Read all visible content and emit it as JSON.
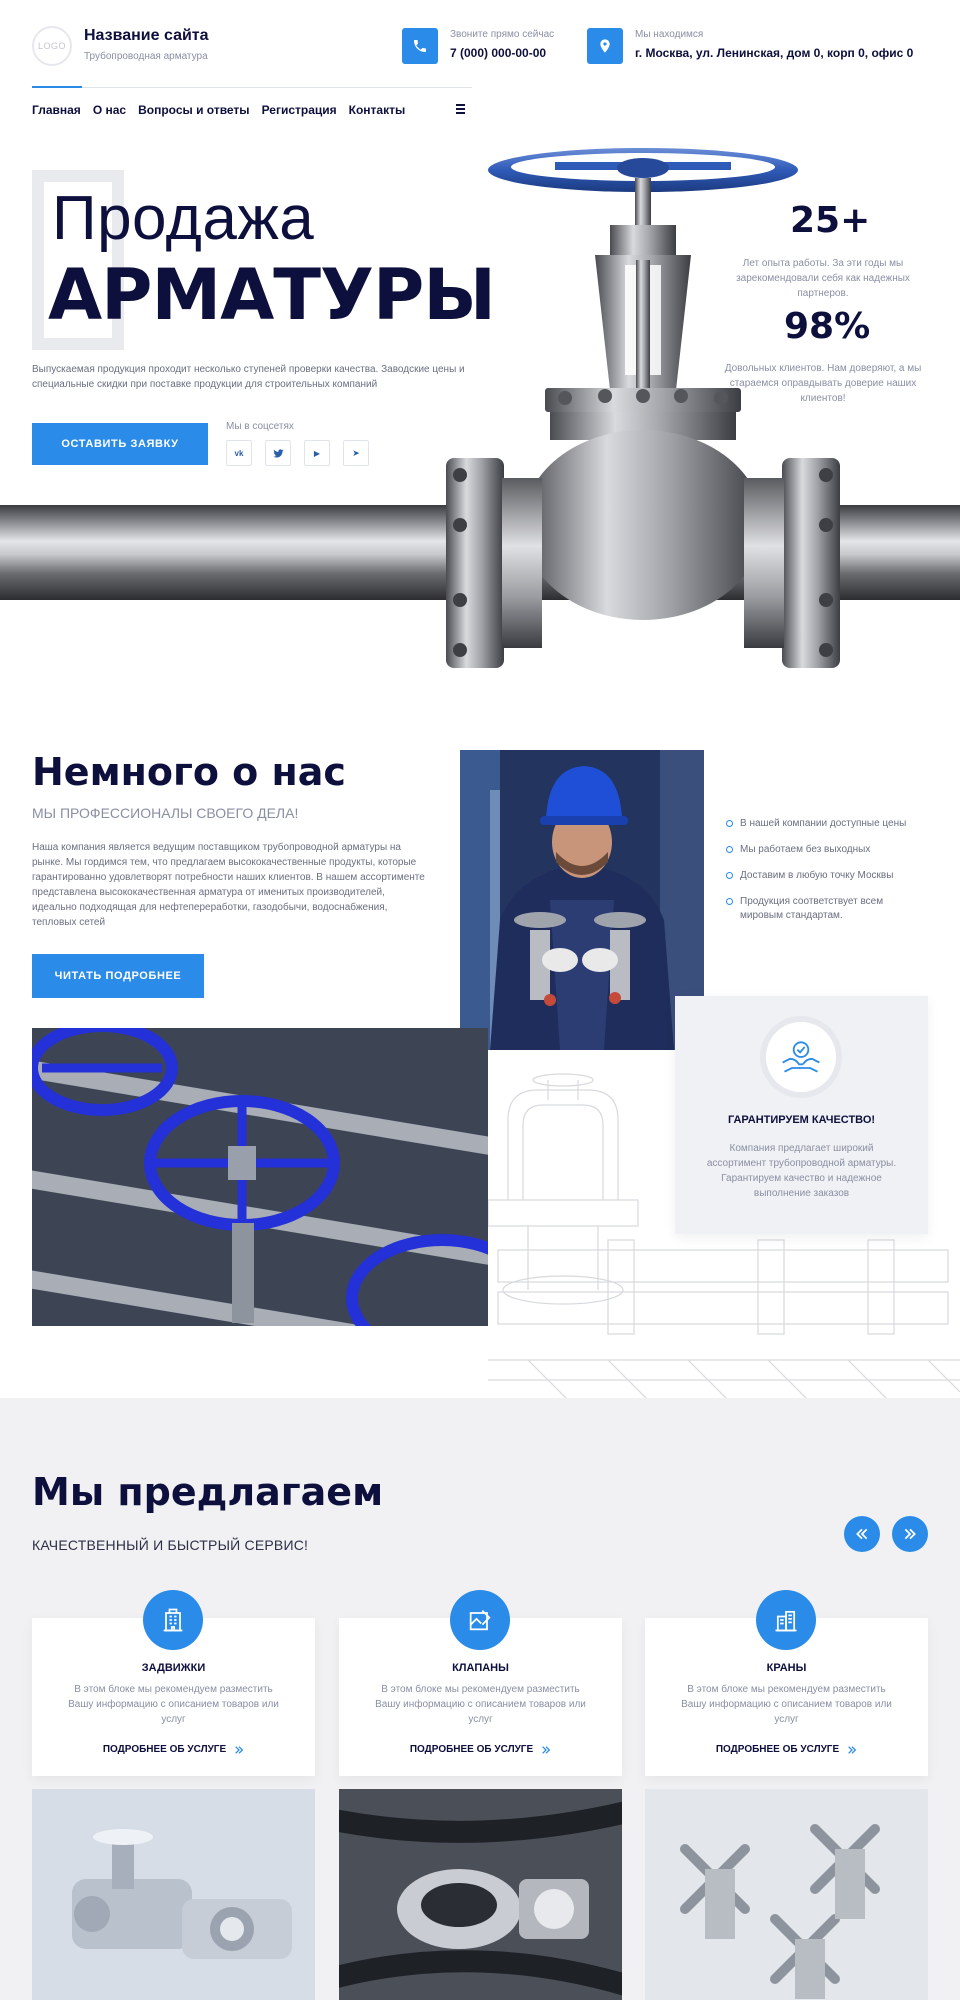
{
  "header": {
    "logo_text": "LOGO",
    "site_name": "Название сайта",
    "site_subtitle": "Трубопроводная арматура",
    "phone_label": "Звоните прямо сейчас",
    "phone_value": "7 (000) 000-00-00",
    "address_label": "Мы находимся",
    "address_value": "г. Москва, ул. Ленинская, дом 0, корп 0, офис 0"
  },
  "nav": {
    "items": [
      "Главная",
      "О нас",
      "Вопросы и ответы",
      "Регистрация",
      "Контакты"
    ],
    "active_index": 0
  },
  "hero": {
    "title_line1": "Продажа",
    "title_line2": "АРМАТУРЫ",
    "description": "Выпускаемая продукция проходит несколько ступеней проверки качества. Заводские цены и специальные скидки при поставке продукции для строительных компаний",
    "cta_label": "ОСТАВИТЬ ЗАЯВКУ",
    "socials_label": "Мы в соцсетях",
    "socials": [
      {
        "icon": "vk-icon",
        "glyph": "vk"
      },
      {
        "icon": "twitter-icon",
        "glyph": "t"
      },
      {
        "icon": "youtube-icon",
        "glyph": "▶"
      },
      {
        "icon": "telegram-icon",
        "glyph": "➤"
      }
    ],
    "stats": [
      {
        "value": "25+",
        "text": "Лет опыта работы. За эти годы мы зарекомендовали себя как надежных партнеров."
      },
      {
        "value": "98%",
        "text": "Довольных клиентов. Нам доверяют, а мы стараемся оправдывать доверие наших клиентов!"
      }
    ]
  },
  "about": {
    "title": "Немного о нас",
    "subtitle": "МЫ ПРОФЕССИОНАЛЫ СВОЕГО ДЕЛА!",
    "text": "Наша компания является ведущим поставщиком трубопроводной арматуры на рынке. Мы гордимся тем, что предлагаем высококачественные продукты, которые гарантированно удовлетворят потребности наших клиентов. В нашем ассортименте представлена высококачественная арматура от именитых производителей, идеально подходящая для нефтепереработки, газодобычи, водоснабжения, тепловых сетей",
    "button_label": "ЧИТАТЬ ПОДРОБНЕЕ",
    "features": [
      "В нашей компании доступные цены",
      "Мы работаем без выходных",
      "Доставим в любую точку Москвы",
      "Продукция соответствует всем мировым стандартам."
    ],
    "quality": {
      "title": "ГАРАНТИРУЕМ КАЧЕСТВО!",
      "text": "Компания предлагает широкий ассортимент трубопроводной арматуры. Гарантируем качество и надежное выполнение заказов"
    }
  },
  "services": {
    "title": "Мы предлагаем",
    "subtitle": "КАЧЕСТВЕННЫЙ И БЫСТРЫЙ СЕРВИС!",
    "cards": [
      {
        "title": "ЗАДВИЖКИ",
        "text": "В этом блоке мы рекомендуем разместить Вашу информацию с описанием товаров или услуг",
        "link": "ПОДРОБНЕЕ ОБ УСЛУГЕ"
      },
      {
        "title": "КЛАПАНЫ",
        "text": "В этом блоке мы рекомендуем разместить Вашу информацию с описанием товаров или услуг",
        "link": "ПОДРОБНЕЕ ОБ УСЛУГЕ"
      },
      {
        "title": "КРАНЫ",
        "text": "В этом блоке мы рекомендуем разместить Вашу информацию с описанием товаров или услуг",
        "link": "ПОДРОБНЕЕ ОБ УСЛУГЕ"
      }
    ]
  },
  "colors": {
    "accent": "#2b8be8",
    "heading": "#0d0f3c",
    "muted": "#8a8fa3",
    "section_bg": "#f1f1f3"
  }
}
